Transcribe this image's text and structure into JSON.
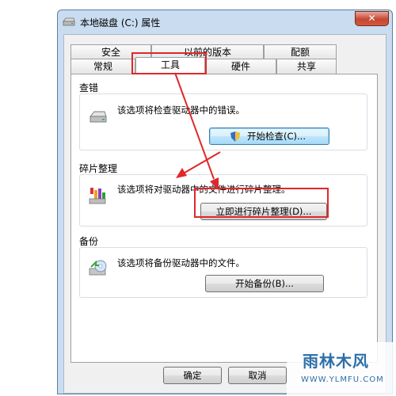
{
  "window": {
    "title": "本地磁盘 (C:) 属性",
    "close_label": "✕"
  },
  "tabs_row1": [
    {
      "label": "安全"
    },
    {
      "label": "以前的版本"
    },
    {
      "label": "配额"
    }
  ],
  "tabs_row2": [
    {
      "label": "常规"
    },
    {
      "label": "工具",
      "active": true
    },
    {
      "label": "硬件"
    },
    {
      "label": "共享"
    }
  ],
  "groups": {
    "error_check": {
      "title": "查错",
      "description": "该选项将检查驱动器中的错误。",
      "button": "开始检查(C)..."
    },
    "defrag": {
      "title": "碎片整理",
      "description": "该选项将对驱动器中的文件进行碎片整理。",
      "button": "立即进行碎片整理(D)..."
    },
    "backup": {
      "title": "备份",
      "description": "该选项将备份驱动器中的文件。",
      "button": "开始备份(B)..."
    }
  },
  "footer": {
    "ok": "确定",
    "cancel": "取消"
  },
  "watermark": {
    "text": "雨林木风",
    "sub": "WWW.YLMFU.COM"
  },
  "colors": {
    "annotation_red": "#e0272b",
    "title_bar": "#c9dcf0",
    "close_red": "#c74632"
  },
  "icons": {
    "title": "drive-icon",
    "error_check": "drive-icon",
    "defrag": "defrag-icon",
    "backup": "backup-icon",
    "check_button": "shield-icon"
  }
}
